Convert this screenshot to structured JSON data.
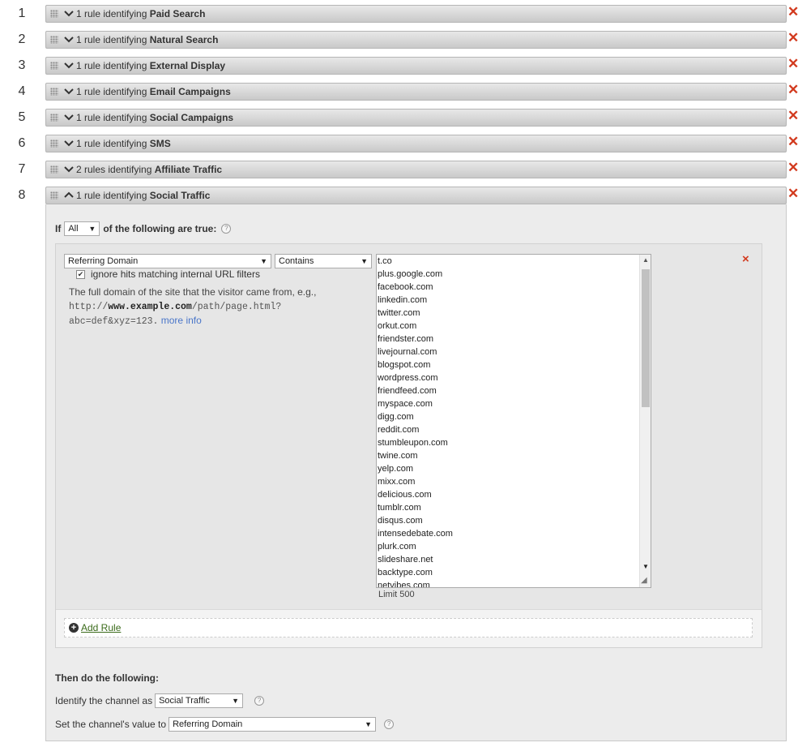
{
  "rules": [
    {
      "num": "1",
      "prefix": "1 rule identifying",
      "name": "Paid Search",
      "expanded": false
    },
    {
      "num": "2",
      "prefix": "1 rule identifying",
      "name": "Natural Search",
      "expanded": false
    },
    {
      "num": "3",
      "prefix": "1 rule identifying",
      "name": "External Display",
      "expanded": false
    },
    {
      "num": "4",
      "prefix": "1 rule identifying",
      "name": "Email Campaigns",
      "expanded": false
    },
    {
      "num": "5",
      "prefix": "1 rule identifying",
      "name": "Social Campaigns",
      "expanded": false
    },
    {
      "num": "6",
      "prefix": "1 rule identifying",
      "name": "SMS",
      "expanded": false
    },
    {
      "num": "7",
      "prefix": "2 rules identifying",
      "name": "Affiliate Traffic",
      "expanded": false
    },
    {
      "num": "8",
      "prefix": "1 rule identifying",
      "name": "Social Traffic",
      "expanded": true
    }
  ],
  "condition": {
    "if_label": "If",
    "match_select": "All",
    "suffix": "of the following are true:",
    "help": "?"
  },
  "rule": {
    "field_select": "Referring Domain",
    "operator_select": "Contains",
    "ignore_label": "ignore hits matching internal URL filters",
    "ignore_checked": true,
    "desc_text": "The full domain of the site that the visitor came from, e.g.,",
    "example_prefix": "http://",
    "example_domain": "www.example.com",
    "example_path": "/path/page.html?",
    "example_query": "abc=def&xyz=123.",
    "more_info": "more info",
    "remove": "×",
    "limit": "Limit 500",
    "values": [
      "t.co",
      "plus.google.com",
      "facebook.com",
      "linkedin.com",
      "twitter.com",
      "orkut.com",
      "friendster.com",
      "livejournal.com",
      "blogspot.com",
      "wordpress.com",
      "friendfeed.com",
      "myspace.com",
      "digg.com",
      "reddit.com",
      "stumbleupon.com",
      "twine.com",
      "yelp.com",
      "mixx.com",
      "delicious.com",
      "tumblr.com",
      "disqus.com",
      "intensedebate.com",
      "plurk.com",
      "slideshare.net",
      "backtype.com",
      "netvibes.com"
    ]
  },
  "add_rule": "Add Rule",
  "then": {
    "title": "Then do the following:",
    "identify_label": "Identify the channel as",
    "identify_select": "Social Traffic",
    "value_label": "Set the channel's value to",
    "value_select": "Referring Domain",
    "help": "?"
  },
  "colors": {
    "remove": "#d23a1e",
    "link": "#4a76c9",
    "add_link": "#3b6b1b"
  }
}
